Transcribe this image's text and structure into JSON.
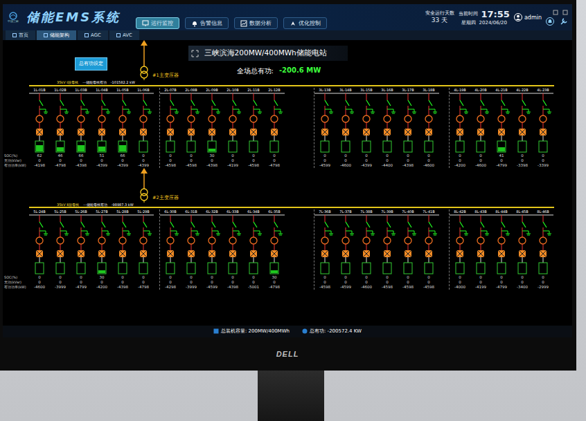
{
  "header": {
    "logo": "中国三峡",
    "title": "储能EMS系统",
    "nav": [
      {
        "label": "运行监控",
        "selected": true
      },
      {
        "label": "告警信息",
        "selected": false
      },
      {
        "label": "数据分析",
        "selected": false
      },
      {
        "label": "优化控制",
        "selected": false
      }
    ],
    "safe_days_label": "安全运行天数",
    "safe_days": "33 天",
    "time_label": "当前时间",
    "time": "17:55",
    "weekday": "星期四",
    "date": "2024/06/20",
    "user": "admin"
  },
  "tabs": [
    {
      "label": "首页",
      "selected": false
    },
    {
      "label": "储能架构",
      "selected": true
    },
    {
      "label": "AGC",
      "selected": false
    },
    {
      "label": "AVC",
      "selected": false
    }
  ],
  "station": {
    "title": "三峡滨海200MW/400MWh储能电站",
    "total_label": "全场总有功:",
    "total_value": "-200.6 MW",
    "setpoint_button": "总有功设定"
  },
  "row_labels": [
    "SOC(%)",
    "无功(kVar)",
    "有功功率(kW)"
  ],
  "sections": [
    {
      "bus": "35kV Ⅰ段母线",
      "bus_power_label": "一储能母线有功",
      "bus_power": "-101582.2 kW",
      "transformer": "#1主变压器",
      "groups": [
        {
          "units": [
            {
              "name": "1L-01B",
              "soc": "62",
              "q": "0",
              "p": "-4198",
              "level": 0.62
            },
            {
              "name": "1L-02B",
              "soc": "46",
              "q": "0",
              "p": "-4798",
              "level": 0.46
            },
            {
              "name": "1L-03B",
              "soc": "66",
              "q": "0",
              "p": "-4398",
              "level": 0.66
            },
            {
              "name": "1L-04B",
              "soc": "51",
              "q": "0",
              "p": "-4399",
              "level": 0.51
            },
            {
              "name": "1L-05B",
              "soc": "66",
              "q": "0",
              "p": "-4399",
              "level": 0.66
            },
            {
              "name": "1L-06B",
              "soc": "0",
              "q": "0",
              "p": "-4399",
              "level": 0
            }
          ]
        },
        {
          "units": [
            {
              "name": "2L-07B",
              "soc": "0",
              "q": "0",
              "p": "-4598",
              "level": 0
            },
            {
              "name": "2L-08B",
              "soc": "0",
              "q": "0",
              "p": "-4598",
              "level": 0
            },
            {
              "name": "2L-09B",
              "soc": "30",
              "q": "0",
              "p": "-4398",
              "level": 0.3
            },
            {
              "name": "2L-10B",
              "soc": "0",
              "q": "0",
              "p": "-4199",
              "level": 0
            },
            {
              "name": "2L-11B",
              "soc": "0",
              "q": "0",
              "p": "-4598",
              "level": 0
            },
            {
              "name": "2L-12B",
              "soc": "0",
              "q": "0",
              "p": "-4798",
              "level": 0
            }
          ]
        },
        {
          "units": [
            {
              "name": "3L-13B",
              "soc": "0",
              "q": "0",
              "p": "-4599",
              "level": 0
            },
            {
              "name": "3L-14B",
              "soc": "0",
              "q": "0",
              "p": "-4600",
              "level": 0
            },
            {
              "name": "3L-15B",
              "soc": "0",
              "q": "0",
              "p": "-4399",
              "level": 0
            },
            {
              "name": "3L-16B",
              "soc": "0",
              "q": "0",
              "p": "-4400",
              "level": 0
            },
            {
              "name": "3L-17B",
              "soc": "0",
              "q": "0",
              "p": "-4398",
              "level": 0
            },
            {
              "name": "3L-18B",
              "soc": "0",
              "q": "0",
              "p": "-4600",
              "level": 0
            }
          ]
        },
        {
          "units": [
            {
              "name": "4L-19B",
              "soc": "0",
              "q": "0",
              "p": "-4200",
              "level": 0
            },
            {
              "name": "4L-20B",
              "soc": "0",
              "q": "0",
              "p": "-4600",
              "level": 0
            },
            {
              "name": "4L-21B",
              "soc": "41",
              "q": "0",
              "p": "-4799",
              "level": 0.41
            },
            {
              "name": "4L-22B",
              "soc": "0",
              "q": "0",
              "p": "-3398",
              "level": 0
            },
            {
              "name": "4L-23B",
              "soc": "0",
              "q": "0",
              "p": "-3399",
              "level": 0
            }
          ]
        }
      ]
    },
    {
      "bus": "35kV Ⅱ段母线",
      "bus_power_label": "一储能母线有功",
      "bus_power": "-98987.3 kW",
      "transformer": "#2主变压器",
      "groups": [
        {
          "units": [
            {
              "name": "5L-24B",
              "soc": "0",
              "q": "0",
              "p": "-4600",
              "level": 0
            },
            {
              "name": "5L-25B",
              "soc": "0",
              "q": "0",
              "p": "-3999",
              "level": 0
            },
            {
              "name": "5L-26B",
              "soc": "0",
              "q": "0",
              "p": "-4799",
              "level": 0
            },
            {
              "name": "5L-27B",
              "soc": "30",
              "q": "0",
              "p": "-4200",
              "level": 0.3
            },
            {
              "name": "5L-28B",
              "soc": "0",
              "q": "0",
              "p": "-4398",
              "level": 0
            },
            {
              "name": "5L-29B",
              "soc": "0",
              "q": "0",
              "p": "-4798",
              "level": 0
            }
          ]
        },
        {
          "units": [
            {
              "name": "6L-30B",
              "soc": "0",
              "q": "0",
              "p": "-4298",
              "level": 0
            },
            {
              "name": "6L-31B",
              "soc": "0",
              "q": "0",
              "p": "-3999",
              "level": 0
            },
            {
              "name": "6L-32B",
              "soc": "0",
              "q": "0",
              "p": "-4599",
              "level": 0
            },
            {
              "name": "6L-33B",
              "soc": "0",
              "q": "0",
              "p": "-4398",
              "level": 0
            },
            {
              "name": "6L-34B",
              "soc": "0",
              "q": "0",
              "p": "-5001",
              "level": 0
            },
            {
              "name": "6L-35B",
              "soc": "30",
              "q": "0",
              "p": "-4798",
              "level": 0.3
            }
          ]
        },
        {
          "units": [
            {
              "name": "7L-36B",
              "soc": "0",
              "q": "0",
              "p": "-4598",
              "level": 0
            },
            {
              "name": "7L-37B",
              "soc": "0",
              "q": "0",
              "p": "-4599",
              "level": 0
            },
            {
              "name": "7L-38B",
              "soc": "0",
              "q": "0",
              "p": "-4600",
              "level": 0
            },
            {
              "name": "7L-39B",
              "soc": "0",
              "q": "0",
              "p": "-4598",
              "level": 0
            },
            {
              "name": "7L-40B",
              "soc": "0",
              "q": "0",
              "p": "-4598",
              "level": 0
            },
            {
              "name": "7L-41B",
              "soc": "0",
              "q": "0",
              "p": "-4598",
              "level": 0
            }
          ]
        },
        {
          "units": [
            {
              "name": "8L-42B",
              "soc": "0",
              "q": "0",
              "p": "-4000",
              "level": 0
            },
            {
              "name": "8L-43B",
              "soc": "0",
              "q": "0",
              "p": "-4199",
              "level": 0
            },
            {
              "name": "8L-44B",
              "soc": "0",
              "q": "0",
              "p": "-4799",
              "level": 0
            },
            {
              "name": "8L-45B",
              "soc": "0",
              "q": "0",
              "p": "-3400",
              "level": 0
            },
            {
              "name": "8L-46B",
              "soc": "0",
              "q": "0",
              "p": "-2999",
              "level": 0
            }
          ]
        }
      ]
    }
  ],
  "status_bar": {
    "capacity": "总装机容量: 200MW/400MWh",
    "power": "总有功: -200572.4 KW"
  },
  "monitor": {
    "brand": "DELL"
  }
}
